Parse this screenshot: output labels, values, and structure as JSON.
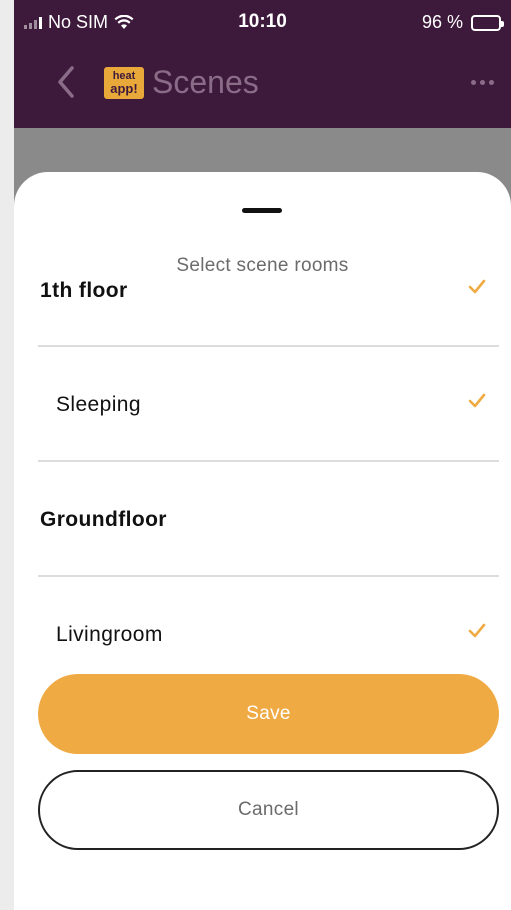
{
  "status_bar": {
    "carrier": "No SIM",
    "time": "10:10",
    "battery": "96 %",
    "battery_level": 0.96
  },
  "header": {
    "title": "Scenes",
    "logo_line1": "heat",
    "logo_line2": "app!",
    "back_icon": "chevron-left-icon",
    "more_icon": "more-horizontal-icon"
  },
  "sheet": {
    "title": "Select scene rooms",
    "rooms": [
      {
        "label": "1th floor",
        "kind": "group",
        "selected": true
      },
      {
        "label": "Sleeping",
        "kind": "item",
        "selected": true
      },
      {
        "label": "Groundfloor",
        "kind": "group",
        "selected": false
      },
      {
        "label": "Livingroom",
        "kind": "item",
        "selected": true
      }
    ],
    "save_label": "Save",
    "cancel_label": "Cancel"
  },
  "colors": {
    "header_bg": "#3d1a3b",
    "accent": "#efaa43",
    "check": "#efaa43"
  }
}
